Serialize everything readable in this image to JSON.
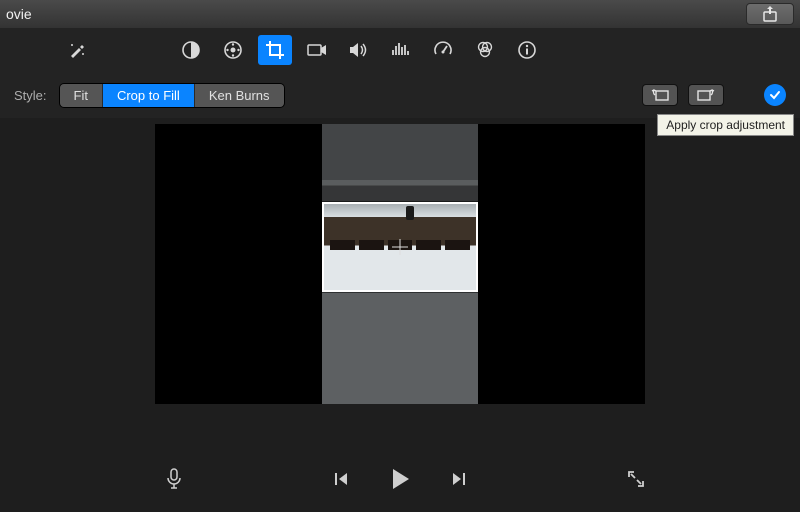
{
  "titlebar": {
    "app_fragment": "ovie"
  },
  "toolbar": {
    "items": [
      {
        "name": "enhance-icon"
      },
      {
        "name": "color-balance-icon"
      },
      {
        "name": "color-correction-icon"
      },
      {
        "name": "crop-icon",
        "active": true
      },
      {
        "name": "stabilization-icon"
      },
      {
        "name": "volume-icon"
      },
      {
        "name": "noise-reduction-icon"
      },
      {
        "name": "speed-icon"
      },
      {
        "name": "color-filter-icon"
      },
      {
        "name": "info-icon"
      }
    ]
  },
  "stylebar": {
    "label": "Style:",
    "segments": [
      {
        "label": "Fit",
        "active": false
      },
      {
        "label": "Crop to Fill",
        "active": true
      },
      {
        "label": "Ken Burns",
        "active": false
      }
    ],
    "rotate_ccw": "rotate-ccw",
    "rotate_cw": "rotate-cw",
    "apply": "apply",
    "tooltip": "Apply crop adjustment"
  },
  "transport": {
    "mic": "microphone",
    "prev": "previous-frame",
    "play": "play",
    "next": "next-frame",
    "fullscreen": "fullscreen"
  }
}
